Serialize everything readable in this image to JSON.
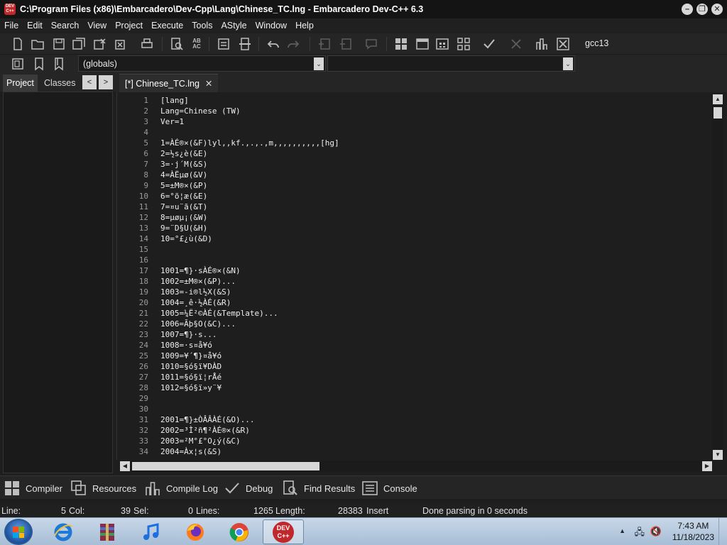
{
  "window": {
    "app_icon_text": "DEV C++",
    "title": "C:\\Program Files (x86)\\Embarcadero\\Dev-Cpp\\Lang\\Chinese_TC.lng - Embarcadero Dev-C++ 6.3"
  },
  "menu": [
    "File",
    "Edit",
    "Search",
    "View",
    "Project",
    "Execute",
    "Tools",
    "AStyle",
    "Window",
    "Help"
  ],
  "toolbar": {
    "compiler_select": "gcc13",
    "scope_select": "(globals)",
    "function_select": ""
  },
  "left_panel": {
    "tabs": [
      "Project",
      "Classes"
    ],
    "prev_arrow": "<",
    "next_arrow": ">"
  },
  "editor": {
    "tab_label": "[*] Chinese_TC.lng",
    "tab_close": "✕",
    "line_numbers": [
      "1",
      "2",
      "3",
      "4",
      "5",
      "6",
      "7",
      "8",
      "9",
      "10",
      "11",
      "12",
      "13",
      "14",
      "15",
      "16",
      "17",
      "18",
      "19",
      "20",
      "21",
      "22",
      "23",
      "24",
      "25",
      "26",
      "27",
      "28",
      "29",
      "30",
      "31",
      "32",
      "33",
      "34"
    ],
    "lines": [
      "[lang]",
      "Lang=Chinese (TW)",
      "Ver=1",
      "",
      "1=ÀÉ®×(&F)lyl,,kf.,.,.,m,,,,,,,,,,[hg]",
      "2=½s¿è(&E)",
      "3=·j´M(&S)",
      "4=ÀËµø(&V)",
      "5=±M®×(&P)",
      "6=°õ¦æ(&E)",
      "7=¤u¨ã(&T)",
      "8=µøµ¡(&W)",
      "9=¨D§U(&H)",
      "10=°£¿ù(&D)",
      "",
      "",
      "1001=¶}·sÀÉ®×(&N)",
      "1002=±M®×(&P)...",
      "1003=-i®l½X(&S)",
      "1004=¸ê·½ÀÉ(&R)",
      "1005=¼Ë²©ÀÉ(&Template)...",
      "1006=Ãþ§O(&C)...",
      "1007=¶}·s...",
      "1008=·s¤å¥ó",
      "1009=¥´¶}¤å¥ó",
      "1010=§ó§ï¥DÀD",
      "1011=§ó§ï¦rÅé",
      "1012=§ó§ï»y¨¥",
      "",
      "",
      "2001=¶}±ÒÂÂÀÉ(&O)...",
      "2002=³Ì²ñ¶²ÀÉ®×(&R)",
      "2003=²M°£°O¿ý(&C)",
      "2004=Àx¦s(&S)"
    ]
  },
  "bottom_tabs": [
    "Compiler",
    "Resources",
    "Compile Log",
    "Debug",
    "Find Results",
    "Console"
  ],
  "status": {
    "line_label": "Line:",
    "line_value": "5",
    "col_label": "Col:",
    "col_value": "39",
    "sel_label": "Sel:",
    "sel_value": "0",
    "lines_label": "Lines:",
    "lines_value": "1265",
    "length_label": "Length:",
    "length_value": "28383",
    "mode": "Insert",
    "message": "Done parsing in 0 seconds"
  },
  "taskbar": {
    "devcpp_label": "DEV C++",
    "time": "7:43 AM",
    "date": "11/18/2023"
  },
  "colors": {
    "background": "#1e1e1e",
    "devcpp_red": "#c0282b",
    "taskbar": "#b8cbe0"
  }
}
